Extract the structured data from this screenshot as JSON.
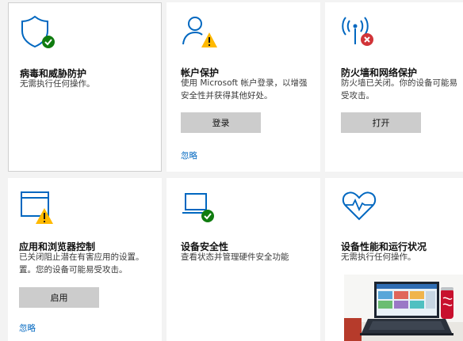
{
  "colors": {
    "accent": "#0067c0",
    "ok": "#107c10",
    "warn": "#ffb900",
    "error": "#d13438"
  },
  "tiles": [
    {
      "title": "病毒和威胁防护",
      "desc": [
        "无需执行任何操作。"
      ],
      "icon": "virus-shield-ok-icon"
    },
    {
      "title": "帐户保护",
      "desc": [
        "使用 Microsoft 帐户登录，以增强",
        "安全性并获得其他好处。"
      ],
      "button": "登录",
      "link": "忽略",
      "icon": "account-warning-icon"
    },
    {
      "title": "防火墙和网络保护",
      "desc": [
        "防火墙已关闭。你的设备可能易",
        "受攻击。"
      ],
      "button": "打开",
      "icon": "firewall-error-icon"
    },
    {
      "title": "应用和浏览器控制",
      "desc": [
        "已关闭阻止潜在有害应用的设置。",
        "置。您的设备可能易受攻击。"
      ],
      "button": "启用",
      "link": "忽略",
      "icon": "app-browser-warning-icon"
    },
    {
      "title": "设备安全性",
      "desc": [
        "查看状态并管理硬件安全功能"
      ],
      "icon": "device-security-ok-icon"
    },
    {
      "title": "设备性能和运行状况",
      "desc": [
        "无需执行任何操作。"
      ],
      "icon": "device-health-heart-icon"
    }
  ]
}
